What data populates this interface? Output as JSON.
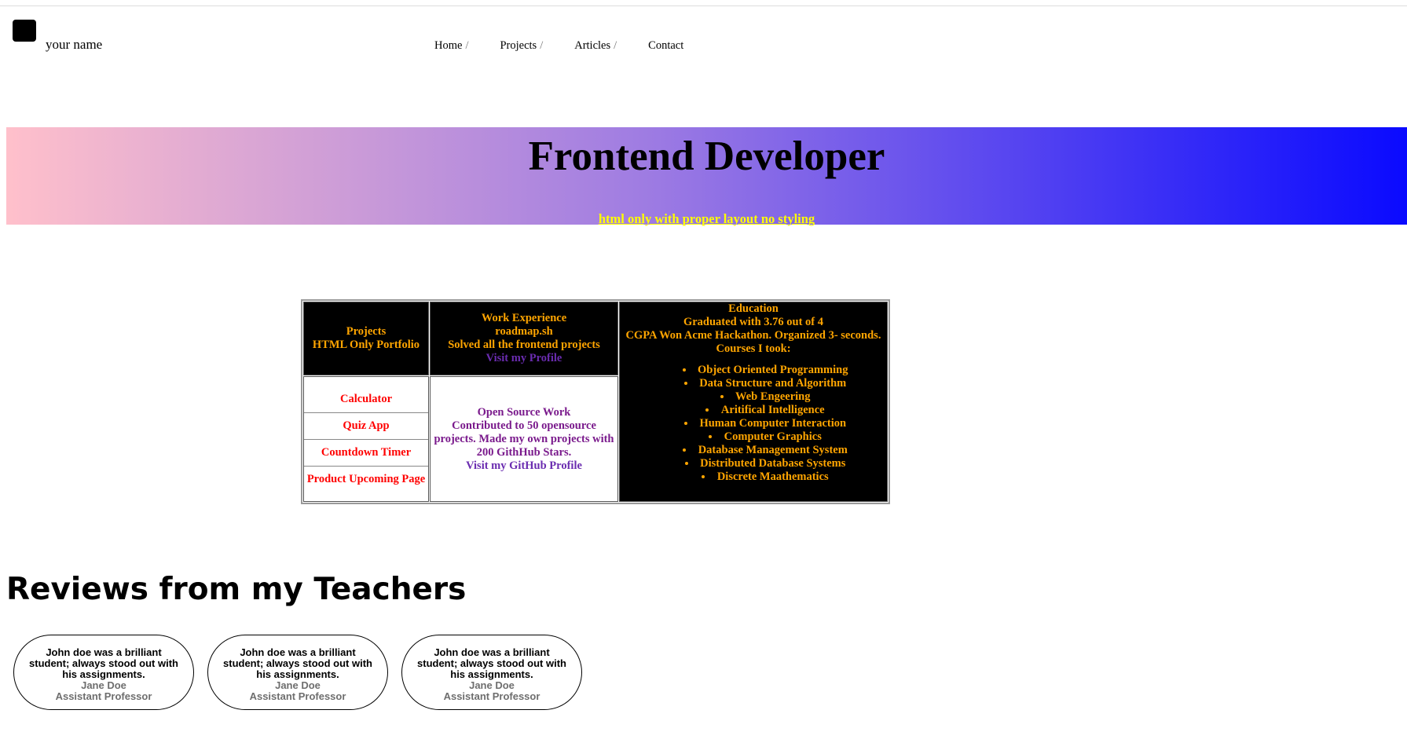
{
  "header": {
    "brand_name": "your name",
    "nav": [
      {
        "label": "Home",
        "sep": "/"
      },
      {
        "label": "Projects",
        "sep": "/"
      },
      {
        "label": "Articles",
        "sep": "/"
      },
      {
        "label": "Contact",
        "sep": ""
      }
    ]
  },
  "hero": {
    "title": "Frontend Developer",
    "subtitle": "html only with proper layout no styling"
  },
  "table": {
    "projects": {
      "title": "Projects",
      "subtitle": "HTML Only Portfolio"
    },
    "work": {
      "title": "Work Experience",
      "company": "roadmap.sh",
      "desc": "Solved all the frontend projects",
      "link": "Visit my Profile"
    },
    "education": {
      "title": "Education",
      "line1": "Graduated with 3.76 out of 4",
      "line2": "CGPA Won Acme Hackathon. Organized 3- seconds.",
      "line3": "Courses I took:",
      "courses": [
        "Object Oriented Programming",
        "Data Structure and Algorithm",
        "Web Engeering",
        "Aritifical Intelligence",
        "Human Computer Interaction",
        "Computer Graphics",
        "Database Management System",
        "Distributed Database Systems",
        "Discrete Maathematics"
      ]
    },
    "project_items": [
      "Calculator",
      "Quiz App",
      "Countdown Timer",
      "Product Upcoming Page"
    ],
    "oss": {
      "title": "Open Source Work",
      "line1": "Contributed to 50 opensource",
      "line2": "projects. Made my own projects with",
      "line3": "200 GithHub Stars.",
      "link": "Visit my GitHub Profile"
    }
  },
  "reviews": {
    "title": "Reviews from my Teachers",
    "items": [
      {
        "text": "John doe was a brilliant student; always stood out with his assignments.",
        "name": "Jane Doe",
        "role": "Assistant Professor"
      },
      {
        "text": "John doe was a brilliant student; always stood out with his assignments.",
        "name": "Jane Doe",
        "role": "Assistant Professor"
      },
      {
        "text": "John doe was a brilliant student; always stood out with his assignments.",
        "name": "Jane Doe",
        "role": "Assistant Professor"
      }
    ]
  }
}
